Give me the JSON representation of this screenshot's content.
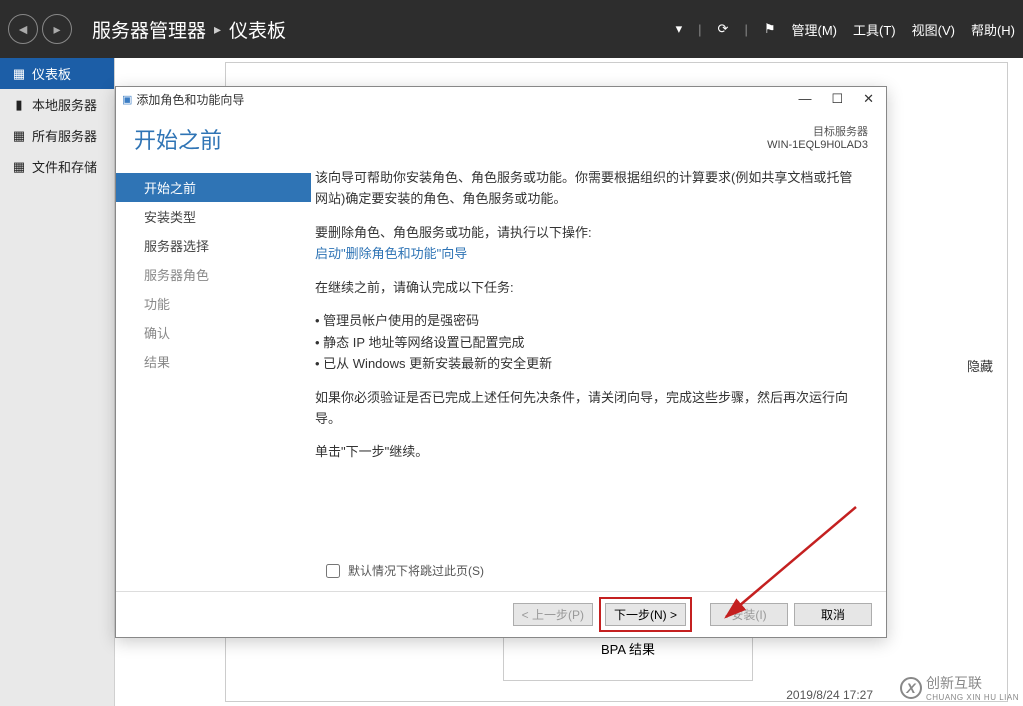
{
  "topbar": {
    "title_a": "服务器管理器",
    "title_b": "仪表板",
    "menu": {
      "manage": "管理(M)",
      "tools": "工具(T)",
      "view": "视图(V)",
      "help": "帮助(H)"
    }
  },
  "sidebar": {
    "items": [
      {
        "label": "仪表板",
        "icon": "▦"
      },
      {
        "label": "本地服务器",
        "icon": "▮"
      },
      {
        "label": "所有服务器",
        "icon": "▦"
      },
      {
        "label": "文件和存储",
        "icon": "▦"
      }
    ]
  },
  "dialog": {
    "title": "添加角色和功能向导",
    "heading": "开始之前",
    "target_label": "目标服务器",
    "target_server": "WIN-1EQL9H0LAD3",
    "steps": [
      "开始之前",
      "安装类型",
      "服务器选择",
      "服务器角色",
      "功能",
      "确认",
      "结果"
    ],
    "content": {
      "intro": "该向导可帮助你安装角色、角色服务或功能。你需要根据组织的计算要求(例如共享文档或托管网站)确定要安装的角色、角色服务或功能。",
      "remove_label": "要删除角色、角色服务或功能，请执行以下操作:",
      "remove_link": "启动\"删除角色和功能\"向导",
      "before_continue": "在继续之前，请确认完成以下任务:",
      "checklist": [
        "管理员帐户使用的是强密码",
        "静态 IP 地址等网络设置已配置完成",
        "已从 Windows 更新安装最新的安全更新"
      ],
      "verify": "如果你必须验证是否已完成上述任何先决条件，请关闭向导，完成这些步骤，然后再次运行向导。",
      "click_next": "单击\"下一步\"继续。"
    },
    "skip_checkbox": "默认情况下将跳过此页(S)",
    "buttons": {
      "prev": "< 上一步(P)",
      "next": "下一步(N) >",
      "install": "安装(I)",
      "cancel": "取消"
    }
  },
  "background": {
    "hide": "隐藏",
    "bpa": "BPA 结果",
    "timestamp": "2019/8/24 17:27"
  },
  "watermark": {
    "text": "创新互联",
    "pinyin": "CHUANG XIN HU LIAN"
  }
}
